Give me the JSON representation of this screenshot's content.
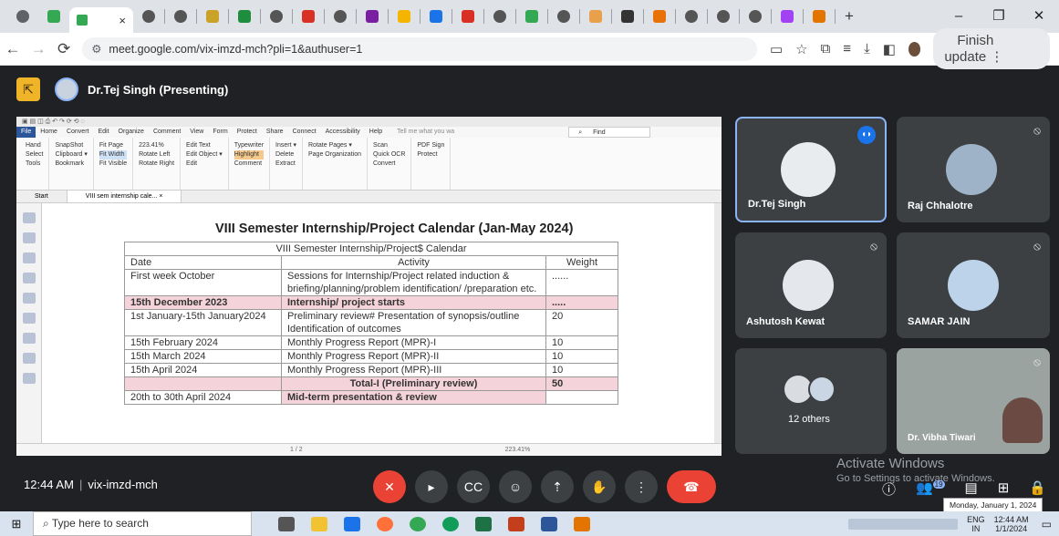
{
  "browser": {
    "active_tab_close": "×",
    "new_tab": "+",
    "window_controls": [
      "–",
      "❐",
      "✕"
    ],
    "url": "meet.google.com/vix-imzd-mch?pli=1&authuser=1",
    "finish_update": "Finish update"
  },
  "meet": {
    "presenter_name": "Dr.Tej Singh (Presenting)",
    "meeting_time": "12:44 AM",
    "meeting_code": "vix-imzd-mch",
    "participants": [
      {
        "name": "Dr.Tej Singh"
      },
      {
        "name": "Raj Chhalotre"
      },
      {
        "name": "Ashutosh Kewat"
      },
      {
        "name": "SAMAR JAIN"
      },
      {
        "name": "12 others"
      },
      {
        "name": "Dr. Vibha Tiwari"
      }
    ],
    "people_badge": "19"
  },
  "pdf": {
    "menu": [
      "File",
      "Home",
      "Convert",
      "Edit",
      "Organize",
      "Comment",
      "View",
      "Form",
      "Protect",
      "Share",
      "Connect",
      "Accessibility",
      "Help"
    ],
    "tell_me": "Tell me what you wa",
    "find": "Find",
    "ribbon": [
      {
        "lines": [
          "Hand",
          "Select",
          "Tools"
        ]
      },
      {
        "lines": [
          "SnapShot",
          "Clipboard ▾",
          "Bookmark"
        ]
      },
      {
        "lines": [
          "Fit Page",
          "Fit Width",
          "Fit Visible"
        ]
      },
      {
        "lines": [
          "223.41%",
          "Rotate Left",
          "Rotate Right"
        ]
      },
      {
        "lines": [
          "Edit Text",
          "Edit Object ▾",
          "Edit"
        ]
      },
      {
        "lines": [
          "Typewriter",
          "Highlight",
          "Comment"
        ]
      },
      {
        "lines": [
          "Insert ▾",
          "Delete",
          "Extract"
        ]
      },
      {
        "lines": [
          "Rotate Pages ▾",
          "Page Organization",
          ""
        ]
      },
      {
        "lines": [
          "Scan",
          "Quick OCR",
          "Convert"
        ]
      },
      {
        "lines": [
          "PDF Sign",
          "Protect",
          ""
        ]
      }
    ],
    "tabs": [
      "Start",
      "VIII sem internship cale...   ×"
    ],
    "page_indicator": "1 / 2",
    "zoom": "223.41%",
    "doc_title": "VIII Semester Internship/Project Calendar (Jan-May 2024)",
    "table_title": "VIII Semester Internship/Project$ Calendar",
    "columns": [
      "Date",
      "Activity",
      "Weight"
    ],
    "rows": [
      {
        "date": "First week October",
        "activity": "Sessions for Internship/Project related induction & briefing/planning/problem identification/ /preparation etc.",
        "weight": "......"
      },
      {
        "date": "15th December 2023",
        "activity": "Internship/ project starts",
        "weight": "....."
      },
      {
        "date": "1st January-15th January2024",
        "activity": "Preliminary review# Presentation of synopsis/outline Identification of outcomes",
        "weight": "20"
      },
      {
        "date": "15th February 2024",
        "activity": "Monthly Progress Report (MPR)-I",
        "weight": "10"
      },
      {
        "date": "15th March 2024",
        "activity": "Monthly Progress Report (MPR)-II",
        "weight": "10"
      },
      {
        "date": "15th April 2024",
        "activity": "Monthly Progress Report (MPR)-III",
        "weight": "10"
      },
      {
        "date": "",
        "activity": "Total-I (Preliminary review)",
        "weight": "50"
      },
      {
        "date": "20th to 30th April 2024",
        "activity": "Mid-term presentation & review",
        "weight": ""
      }
    ]
  },
  "windows": {
    "activate_line1": "Activate Windows",
    "activate_line2": "Go to Settings to activate Windows.",
    "date_tooltip": "Monday, January 1, 2024",
    "search_placeholder": "Type here to search",
    "lang": "ENG",
    "lang2": "IN",
    "time": "12:44 AM",
    "date": "1/1/2024"
  }
}
